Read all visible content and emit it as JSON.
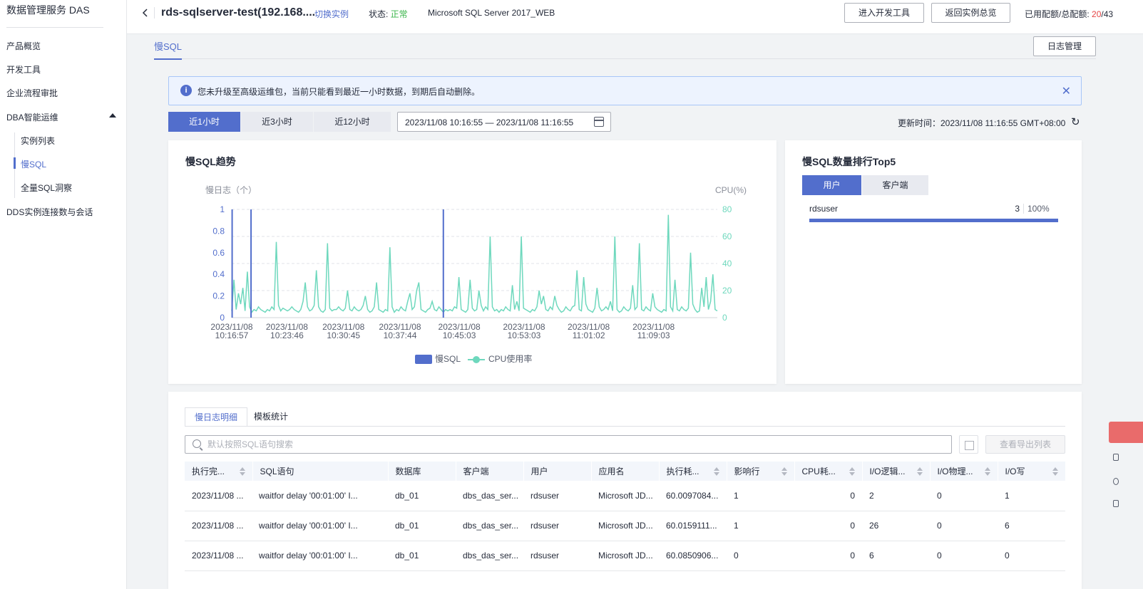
{
  "sidebar": {
    "brand": "数据管理服务 DAS",
    "items": [
      {
        "label": "产品概览"
      },
      {
        "label": "开发工具"
      },
      {
        "label": "企业流程审批"
      },
      {
        "label": "DBA智能运维"
      },
      {
        "label": "实例列表"
      },
      {
        "label": "慢SQL"
      },
      {
        "label": "全量SQL洞察"
      },
      {
        "label": "DDS实例连接数与会话"
      }
    ]
  },
  "topbar": {
    "instance_title": "rds-sqlserver-test(192.168....",
    "switch_label": "切换实例",
    "status_label": "状态: ",
    "status_value": "正常",
    "engine": "Microsoft SQL Server 2017_WEB",
    "dev_tool_btn": "进入开发工具",
    "back_overview_btn": "返回实例总览",
    "quota_label": "已用配额/总配额: ",
    "quota_used": "20",
    "quota_total": "/43"
  },
  "tabs": {
    "slow_sql": "慢SQL",
    "log_mgmt_btn": "日志管理"
  },
  "alert": {
    "text": "您未升级至高级运维包，当前只能看到最近一小时数据，到期后自动删除。"
  },
  "time_filter": {
    "ranges": [
      "近1小时",
      "近3小时",
      "近12小时"
    ],
    "active_index": 0,
    "date_range": "2023/11/08 10:16:55 — 2023/11/08 11:16:55",
    "update_time": "更新时间：2023/11/08 11:16:55 GMT+08:00"
  },
  "trend_card": {
    "title": "慢SQL趋势",
    "legend_slow": "慢SQL",
    "legend_cpu": "CPU使用率"
  },
  "chart_data": {
    "type": "line",
    "ylabel_left": "慢日志（个）",
    "ylabel_right": "CPU(%)",
    "ylim_left": [
      0,
      1
    ],
    "ylim_right": [
      0,
      80
    ],
    "yticks_left": [
      "0",
      "0.2",
      "0.4",
      "0.6",
      "0.8",
      "1"
    ],
    "yticks_right": [
      "0",
      "20",
      "40",
      "60",
      "80"
    ],
    "xticks": [
      [
        "2023/11/08",
        "10:16:57"
      ],
      [
        "2023/11/08",
        "10:23:46"
      ],
      [
        "2023/11/08",
        "10:30:45"
      ],
      [
        "2023/11/08",
        "10:37:44"
      ],
      [
        "2023/11/08",
        "10:45:03"
      ],
      [
        "2023/11/08",
        "10:53:03"
      ],
      [
        "2023/11/08",
        "11:01:02"
      ],
      [
        "2023/11/08",
        "11:09:03"
      ]
    ],
    "x_start": "2023/11/08 10:16:57",
    "x_end": "2023/11/08 11:16:55",
    "series": [
      {
        "name": "慢SQL",
        "axis": "left",
        "color": "#526ecc",
        "points": [
          {
            "x": "2023/11/08 10:17:00",
            "y": 1
          },
          {
            "x": "2023/11/08 10:19:20",
            "y": 1
          },
          {
            "x": "2023/11/08 10:43:05",
            "y": 1
          }
        ]
      },
      {
        "name": "CPU使用率",
        "axis": "right",
        "color": "#6ed8bd",
        "values": [
          5,
          28,
          6,
          18,
          10,
          22,
          5,
          34,
          8,
          4,
          6,
          5,
          8,
          6,
          5,
          4,
          6,
          5,
          8,
          6,
          56,
          9,
          5,
          7,
          6,
          5,
          6,
          8,
          6,
          5,
          4,
          6,
          12,
          26,
          8,
          5,
          6,
          9,
          35,
          8,
          5,
          4,
          6,
          55,
          7,
          5,
          6,
          6,
          8,
          6,
          5,
          7,
          20,
          6,
          5,
          8,
          6,
          5,
          6,
          9,
          16,
          6,
          4,
          5,
          8,
          26,
          6,
          5,
          4,
          6,
          5,
          52,
          8,
          4,
          6,
          5,
          8,
          6,
          5,
          12,
          18,
          6,
          8,
          20,
          26,
          6,
          5,
          4,
          6,
          7,
          12,
          6,
          5,
          8,
          6,
          4,
          6,
          5,
          6,
          5,
          8,
          7,
          30,
          6,
          5,
          4,
          6,
          28,
          7,
          5,
          6,
          20,
          9,
          5,
          8,
          6,
          60,
          8,
          5,
          6,
          4,
          6,
          5,
          8,
          6,
          5,
          24,
          6,
          12,
          5,
          60,
          7,
          6,
          5,
          4,
          6,
          5,
          8,
          20,
          10,
          16,
          6,
          5,
          8,
          6,
          16,
          9,
          6,
          4,
          5,
          8,
          6,
          5,
          8,
          9,
          35,
          6,
          5,
          30,
          10,
          6,
          5,
          4,
          7,
          22,
          8,
          5,
          6,
          8,
          6,
          12,
          5,
          60,
          6,
          4,
          5,
          8,
          6,
          5,
          7,
          24,
          6,
          8,
          55,
          6,
          5,
          8,
          6,
          5,
          18,
          8,
          6,
          5,
          4,
          6,
          5,
          76,
          8,
          5,
          28,
          6,
          5,
          8,
          6,
          5,
          7,
          48,
          10,
          6,
          4,
          5,
          22,
          8,
          30,
          6,
          12,
          32,
          6,
          5
        ]
      }
    ]
  },
  "top5_card": {
    "title": "慢SQL数量排行Top5",
    "tabs": [
      "用户",
      "客户端"
    ],
    "active_index": 0,
    "rows": [
      {
        "name": "rdsuser",
        "count": "3",
        "percent": "100%",
        "ratio": 1.0
      }
    ]
  },
  "detail_card": {
    "tabs": [
      "慢日志明细",
      "模板统计"
    ],
    "active_index": 0,
    "search_placeholder": "默认按照SQL语句搜索",
    "export_list_btn": "查看导出列表",
    "columns": [
      "执行完...",
      "SQL语句",
      "数据库",
      "客户端",
      "用户",
      "应用名",
      "执行耗...",
      "影响行",
      "CPU耗...",
      "I/O逻辑...",
      "I/O物理...",
      "I/O写"
    ],
    "rows": [
      [
        "2023/11/08 ...",
        "waitfor delay '00:01:00' I...",
        "db_01",
        "dbs_das_ser...",
        "rdsuser",
        "Microsoft JD...",
        "60.0097084...",
        "1",
        "0",
        "2",
        "0",
        "1"
      ],
      [
        "2023/11/08 ...",
        "waitfor delay '00:01:00' I...",
        "db_01",
        "dbs_das_ser...",
        "rdsuser",
        "Microsoft JD...",
        "60.0159111...",
        "1",
        "0",
        "26",
        "0",
        "6"
      ],
      [
        "2023/11/08 ...",
        "waitfor delay '00:01:00' I...",
        "db_01",
        "dbs_das_ser...",
        "rdsuser",
        "Microsoft JD...",
        "60.0850906...",
        "0",
        "0",
        "6",
        "0",
        "0"
      ]
    ]
  },
  "colors": {
    "accent": "#526ecc",
    "cpu_line": "#6ed8bd",
    "status_ok": "#3ab54a",
    "quota_used": "#e54545"
  }
}
